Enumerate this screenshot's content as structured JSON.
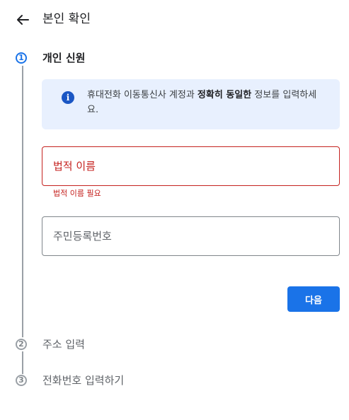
{
  "header": {
    "title": "본인 확인",
    "back_icon": "arrow-back-icon"
  },
  "steps": [
    {
      "number": "1",
      "label": "개인 신원",
      "state": "active"
    },
    {
      "number": "2",
      "label": "주소 입력",
      "state": "inactive"
    },
    {
      "number": "3",
      "label": "전화번호 입력하기",
      "state": "inactive"
    }
  ],
  "info": {
    "icon": "info-icon",
    "text_before": "휴대전화 이동통신사 계정과 ",
    "text_bold": "정확히 동일한",
    "text_after": " 정보를 입력하세요."
  },
  "form": {
    "legal_name_placeholder": "법적 이름",
    "legal_name_value": "",
    "legal_name_error": "법적 이름 필요",
    "resident_number_placeholder": "주민등록번호",
    "resident_number_value": ""
  },
  "next_label": "다음",
  "colors": {
    "accent": "#1a73e8",
    "error": "#c5221f",
    "info_bg": "#e8f0fe"
  }
}
